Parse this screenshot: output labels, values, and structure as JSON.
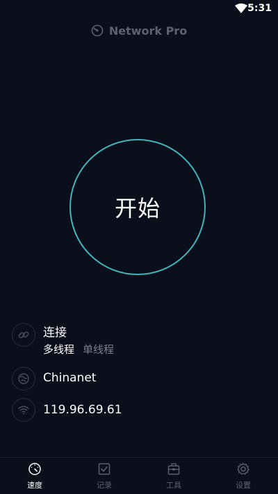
{
  "status_bar": {
    "time": "5:31",
    "wifi_icon": "wifi-icon"
  },
  "app": {
    "title": "Network Pro",
    "logo_icon": "speedometer-icon"
  },
  "start_button": {
    "label": "开始",
    "ring_color": "#3fb6bd"
  },
  "info": {
    "connection": {
      "icon": "link-icon",
      "title": "连接",
      "options": [
        "多线程",
        "单线程"
      ],
      "selected": "多线程"
    },
    "isp": {
      "icon": "globe-icon",
      "name": "Chinanet"
    },
    "ip": {
      "icon": "wifi-icon",
      "address": "119.96.69.61"
    }
  },
  "bottom_nav": {
    "items": [
      {
        "label": "速度",
        "icon": "speedometer-icon",
        "active": true
      },
      {
        "label": "记录",
        "icon": "checkbox-icon",
        "active": false
      },
      {
        "label": "工具",
        "icon": "toolbox-icon",
        "active": false
      },
      {
        "label": "设置",
        "icon": "gear-icon",
        "active": false
      }
    ]
  },
  "colors": {
    "background": "#0b0e1b",
    "accent": "#3fb6bd",
    "muted_text": "#7a7f8d"
  }
}
